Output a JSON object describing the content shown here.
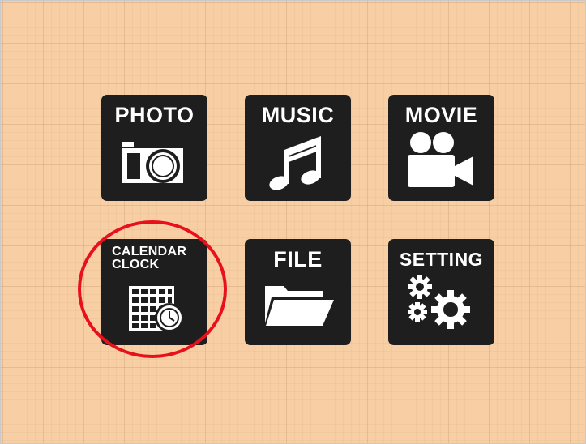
{
  "menu": {
    "photo_label": "PHOTO",
    "music_label": "MUSIC",
    "movie_label": "MOVIE",
    "calendar_label_line1": "CALENDAR",
    "calendar_label_line2": "CLOCK",
    "file_label": "FILE",
    "setting_label": "SETTING"
  },
  "icons": {
    "photo": "camera-icon",
    "music": "music-notes-icon",
    "movie": "video-camera-icon",
    "calendar_clock": "calendar-clock-icon",
    "file": "folder-icon",
    "setting": "gears-icon"
  },
  "highlight": {
    "target": "calendar-clock",
    "color": "#e8101b"
  },
  "colors": {
    "background": "#f8cfa5",
    "tile": "#1f1e1e",
    "tile_text": "#ffffff"
  }
}
